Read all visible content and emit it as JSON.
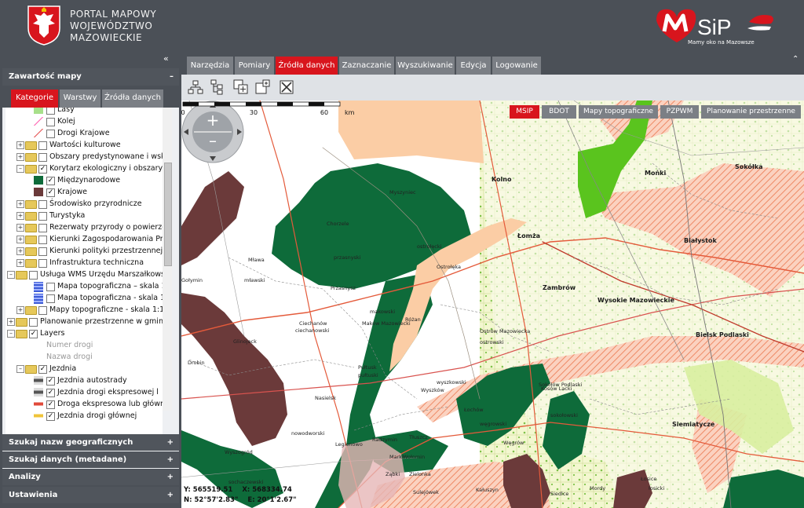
{
  "header": {
    "portal_title_lines": [
      "PORTAL MAPOWY",
      "WOJEWÓDZTWO",
      "MAZOWIECKIE"
    ],
    "logo_text": "SiP",
    "tagline": "Mamy oko na Mazowsze"
  },
  "left_panel": {
    "collapse_symbol": "«",
    "title": "Zawartość mapy",
    "title_toggle": "–",
    "tabs": [
      "Kategorie",
      "Warstwy",
      "Źródła danych"
    ],
    "active_tab": "Kategorie",
    "tree": [
      {
        "label": "Lasy",
        "level": 2,
        "checked": false,
        "folder": false,
        "symbol": "green-fill"
      },
      {
        "label": "Kolej",
        "level": 2,
        "checked": false,
        "folder": false,
        "symbol": "line-pink"
      },
      {
        "label": "Drogi Krajowe",
        "level": 2,
        "checked": false,
        "folder": false,
        "symbol": "line-red"
      },
      {
        "label": "Wartości kulturowe",
        "level": 1,
        "checked": false,
        "folder": true,
        "expander": "+"
      },
      {
        "label": "Obszary predystynowane i wsk",
        "level": 1,
        "checked": false,
        "folder": true,
        "expander": "+"
      },
      {
        "label": "Korytarz ekologiczny i obszary",
        "level": 1,
        "checked": true,
        "folder": true,
        "expander": "–"
      },
      {
        "label": "Międzynarodowe",
        "level": 2,
        "checked": true,
        "folder": false,
        "symbol": "dark-green"
      },
      {
        "label": "Krajowe",
        "level": 2,
        "checked": true,
        "folder": false,
        "symbol": "brown"
      },
      {
        "label": "Środowisko przyrodnicze",
        "level": 1,
        "checked": false,
        "folder": true,
        "expander": "+"
      },
      {
        "label": "Turystyka",
        "level": 1,
        "checked": false,
        "folder": true,
        "expander": "+"
      },
      {
        "label": "Rezerwaty przyrody o powierzc",
        "level": 1,
        "checked": false,
        "folder": true,
        "expander": "+"
      },
      {
        "label": "Kierunki Zagospodarowania Prz",
        "level": 1,
        "checked": false,
        "folder": true,
        "expander": "+"
      },
      {
        "label": "Kierunki polityki przestrzennej",
        "level": 1,
        "checked": false,
        "folder": true,
        "expander": "+"
      },
      {
        "label": "Infrastruktura techniczna",
        "level": 1,
        "checked": false,
        "folder": true,
        "expander": "+"
      },
      {
        "label": "Usługa WMS Urzędu Marszałkowsk",
        "level": 0,
        "checked": false,
        "folder": true,
        "expander": "–"
      },
      {
        "label": "Mapa topograficzna – skala 1:",
        "level": 2,
        "checked": false,
        "folder": false,
        "symbol": "blue-grid"
      },
      {
        "label": "Mapa topograficzna - skala 1:5",
        "level": 2,
        "checked": false,
        "folder": false,
        "symbol": "blue-grid"
      },
      {
        "label": "Mapy topograficzne - skala 1:1",
        "level": 1,
        "checked": false,
        "folder": true,
        "expander": "+"
      },
      {
        "label": "Planowanie przestrzenne w gmina",
        "level": 0,
        "checked": false,
        "folder": true,
        "expander": "+"
      },
      {
        "label": "Layers",
        "level": 0,
        "checked": true,
        "folder": true,
        "expander": "–"
      },
      {
        "label": "Numer drogi",
        "level": 2,
        "checked": false,
        "folder": false,
        "symbol": "none",
        "gray": true
      },
      {
        "label": "Nazwa drogi",
        "level": 2,
        "checked": false,
        "folder": false,
        "symbol": "none",
        "gray": true
      },
      {
        "label": "Jezdnia",
        "level": 1,
        "checked": true,
        "folder": true,
        "expander": "–"
      },
      {
        "label": "Jezdnia autostrady",
        "level": 2,
        "checked": true,
        "folder": false,
        "symbol": "motorway"
      },
      {
        "label": "Jezdnia drogi ekspresowej l",
        "level": 2,
        "checked": true,
        "folder": false,
        "symbol": "motorway"
      },
      {
        "label": "Droga ekspresowa lub główn",
        "level": 2,
        "checked": true,
        "folder": false,
        "symbol": "red-road"
      },
      {
        "label": "Jezdnia drogi głównej",
        "level": 2,
        "checked": true,
        "folder": false,
        "symbol": "yellow-road"
      }
    ],
    "accordions": [
      {
        "label": "Szukaj nazw geograficznych",
        "toggle": "+"
      },
      {
        "label": "Szukaj danych (metadane)",
        "toggle": "+"
      },
      {
        "label": "Analizy",
        "toggle": "+"
      },
      {
        "label": "Ustawienia",
        "toggle": "+"
      }
    ]
  },
  "top_tabs": [
    "Narzędzia",
    "Pomiary",
    "Źródła danych",
    "Zaznaczanie",
    "Wyszukiwanie",
    "Edycja",
    "Logowanie"
  ],
  "active_top_tab": "Źródła danych",
  "top_collapse_symbol": "⌃",
  "toolbar": [
    "tree-collapse-icon",
    "tree-expand-icon",
    "add-layer-icon",
    "add-service-icon",
    "remove-layer-icon"
  ],
  "layer_buttons": [
    "MSIP",
    "BDOT",
    "Mapy topograficzne",
    "PZPWM",
    "Planowanie przestrzenne"
  ],
  "active_layer_button": "MSIP",
  "nav": {
    "zoom_in": "+",
    "zoom_out": "–"
  },
  "coordinates": {
    "y": "Y: 565519.51",
    "x": "X: 568334.74",
    "n": "N: 52°57'2.83\"",
    "e": "E: 20°1'2.67\""
  },
  "scale": {
    "labels": [
      "0",
      "30",
      "60"
    ],
    "unit": "km"
  },
  "places": [
    {
      "name": "Kolno",
      "cls": ""
    },
    {
      "name": "Łomża",
      "cls": ""
    },
    {
      "name": "Zambrów",
      "cls": ""
    },
    {
      "name": "Wysokie Mazowieckie",
      "cls": ""
    },
    {
      "name": "Białystok",
      "cls": ""
    },
    {
      "name": "Mońki",
      "cls": ""
    },
    {
      "name": "Sokółka",
      "cls": ""
    },
    {
      "name": "Bielsk Podlaski",
      "cls": ""
    },
    {
      "name": "Siemiatycze",
      "cls": ""
    },
    {
      "name": "Chorzele",
      "cls": "small"
    },
    {
      "name": "Myszyniec",
      "cls": "small"
    },
    {
      "name": "przasnyski",
      "cls": "small"
    },
    {
      "name": "ostrołęcki",
      "cls": "small"
    },
    {
      "name": "Ostrołęka",
      "cls": "small"
    },
    {
      "name": "Przasnysz",
      "cls": "small"
    },
    {
      "name": "Mława",
      "cls": "small"
    },
    {
      "name": "mławski",
      "cls": "small"
    },
    {
      "name": "Ciechanów",
      "cls": "small"
    },
    {
      "name": "ciechanowski",
      "cls": "small"
    },
    {
      "name": "makowski",
      "cls": "small"
    },
    {
      "name": "Maków Mazowiecki",
      "cls": "small"
    },
    {
      "name": "Różan",
      "cls": "small"
    },
    {
      "name": "Ostrów Mazowiecka",
      "cls": "small"
    },
    {
      "name": "ostrowski",
      "cls": "small"
    },
    {
      "name": "Pułtusk",
      "cls": "small"
    },
    {
      "name": "pułtuski",
      "cls": "small"
    },
    {
      "name": "Nasielsk",
      "cls": "small"
    },
    {
      "name": "wyszkowski",
      "cls": "small"
    },
    {
      "name": "Wyszków",
      "cls": "small"
    },
    {
      "name": "Łochów",
      "cls": "small"
    },
    {
      "name": "węgrowski",
      "cls": "small"
    },
    {
      "name": "Węgrów",
      "cls": "small"
    },
    {
      "name": "Sokołów Podlaski",
      "cls": "small"
    },
    {
      "name": "sokołowski",
      "cls": "small"
    },
    {
      "name": "Kosów Lacki",
      "cls": "small"
    },
    {
      "name": "Gołymin",
      "cls": "small"
    },
    {
      "name": "Glinojeck",
      "cls": "small"
    },
    {
      "name": "Drobin",
      "cls": "small"
    },
    {
      "name": "Wyszogród",
      "cls": "small"
    },
    {
      "name": "nowodworski",
      "cls": "small"
    },
    {
      "name": "Legionowo",
      "cls": "small"
    },
    {
      "name": "Radzymin",
      "cls": "small"
    },
    {
      "name": "Tłuszcz",
      "cls": "small"
    },
    {
      "name": "Marki",
      "cls": "small"
    },
    {
      "name": "Wołomin",
      "cls": "small"
    },
    {
      "name": "Ząbki",
      "cls": "small"
    },
    {
      "name": "Zielonka",
      "cls": "small"
    },
    {
      "name": "Sulejówek",
      "cls": "small"
    },
    {
      "name": "Łosice",
      "cls": "small"
    },
    {
      "name": "łosicki",
      "cls": "small"
    },
    {
      "name": "Siedlce",
      "cls": "small"
    },
    {
      "name": "Mordy",
      "cls": "small"
    },
    {
      "name": "sochaczewski",
      "cls": "small"
    },
    {
      "name": "Kałuszyn",
      "cls": "small"
    }
  ],
  "colors": {
    "header_bg": "#4b5057",
    "accent_red": "#d8151d",
    "tab_gray": "#7b7f85",
    "corridor_international": "#0e6b3a",
    "corridor_national": "#6b3a3a",
    "corridor_hatched": "#f4a184",
    "light_green": "#5ac41e"
  }
}
